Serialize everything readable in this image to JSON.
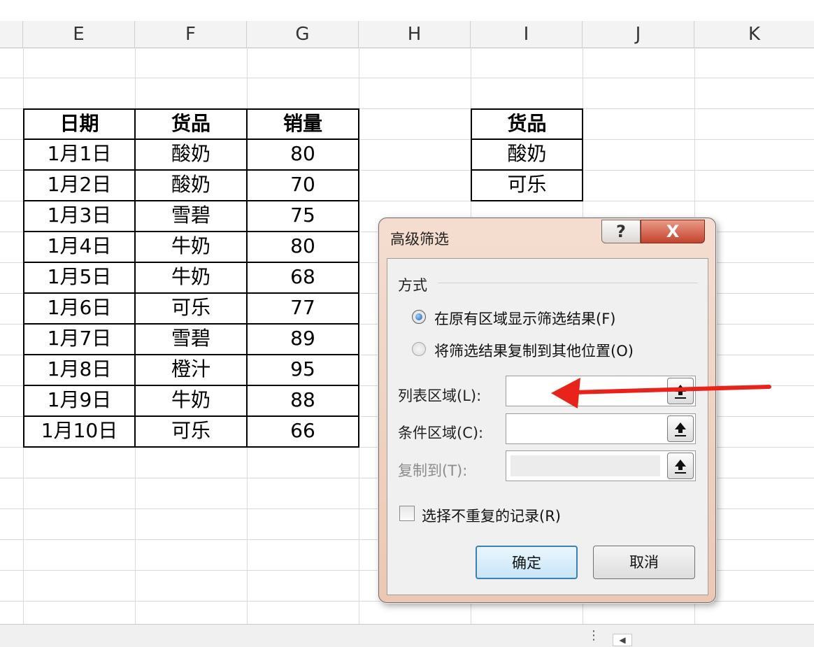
{
  "columns": [
    "E",
    "F",
    "G",
    "H",
    "I",
    "J",
    "K"
  ],
  "main_table": {
    "headers": [
      "日期",
      "货品",
      "销量"
    ],
    "rows": [
      [
        "1月1日",
        "酸奶",
        "80"
      ],
      [
        "1月2日",
        "酸奶",
        "70"
      ],
      [
        "1月3日",
        "雪碧",
        "75"
      ],
      [
        "1月4日",
        "牛奶",
        "80"
      ],
      [
        "1月5日",
        "牛奶",
        "68"
      ],
      [
        "1月6日",
        "可乐",
        "77"
      ],
      [
        "1月7日",
        "雪碧",
        "89"
      ],
      [
        "1月8日",
        "橙汁",
        "95"
      ],
      [
        "1月9日",
        "牛奶",
        "88"
      ],
      [
        "1月10日",
        "可乐",
        "66"
      ]
    ]
  },
  "criteria_table": {
    "header": "货品",
    "rows": [
      "酸奶",
      "可乐"
    ]
  },
  "dialog": {
    "title": "高级筛选",
    "help_label": "?",
    "close_label": "X",
    "group_label": "方式",
    "option_in_place": "在原有区域显示筛选结果(F)",
    "option_copy": "将筛选结果复制到其他位置(O)",
    "list_range_label": "列表区域(L):",
    "list_range_value": "",
    "criteria_range_label": "条件区域(C):",
    "criteria_range_value": "",
    "copy_to_label": "复制到(T):",
    "copy_to_value": "",
    "unique_label": "选择不重复的记录(R)",
    "ok_label": "确定",
    "cancel_label": "取消"
  },
  "colors": {
    "arrow": "#e8231c",
    "ok_border": "#3c7fb1",
    "close_red": "#c4432c"
  }
}
